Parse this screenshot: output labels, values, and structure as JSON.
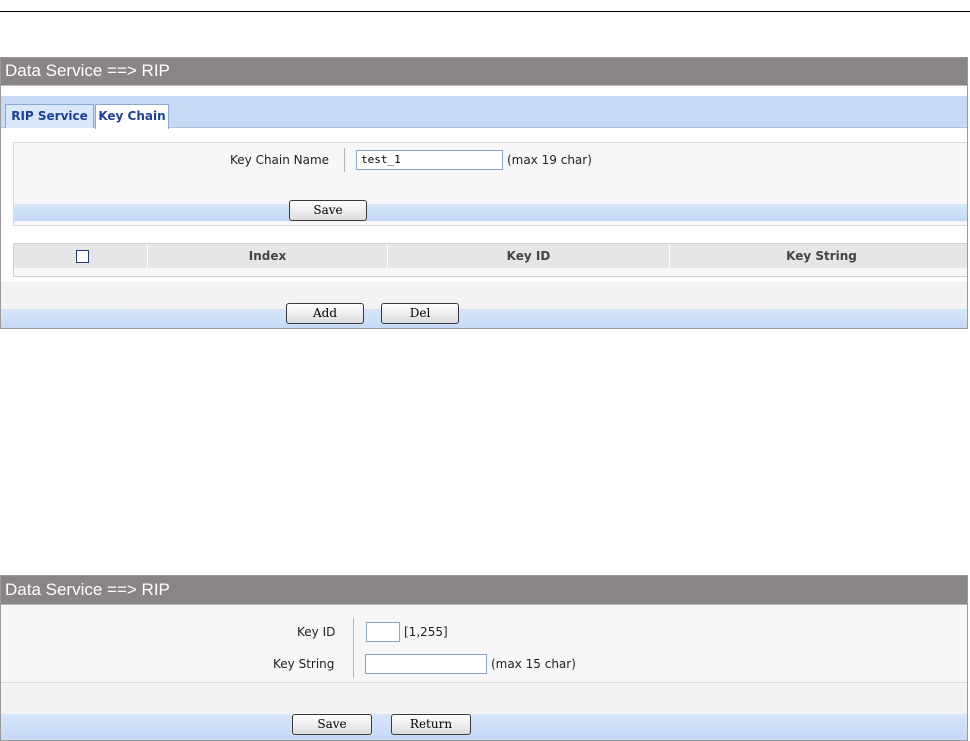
{
  "panel1": {
    "title": "Data Service ==> RIP",
    "tabs": [
      {
        "label": "RIP Service"
      },
      {
        "label": "Key Chain"
      }
    ],
    "form": {
      "key_chain_label": "Key Chain Name",
      "key_chain_value": "test_1",
      "key_chain_hint": "(max 19 char)",
      "save_label": "Save"
    },
    "table": {
      "columns": [
        "Index",
        "Key ID",
        "Key String"
      ]
    },
    "add_label": "Add",
    "del_label": "Del"
  },
  "panel2": {
    "title": "Data Service ==> RIP",
    "key_id_label": "Key ID",
    "key_id_value": "",
    "key_id_hint": "[1,255]",
    "key_string_label": "Key String",
    "key_string_value": "",
    "key_string_hint": "(max 15 char)",
    "save_label": "Save",
    "return_label": "Return"
  }
}
